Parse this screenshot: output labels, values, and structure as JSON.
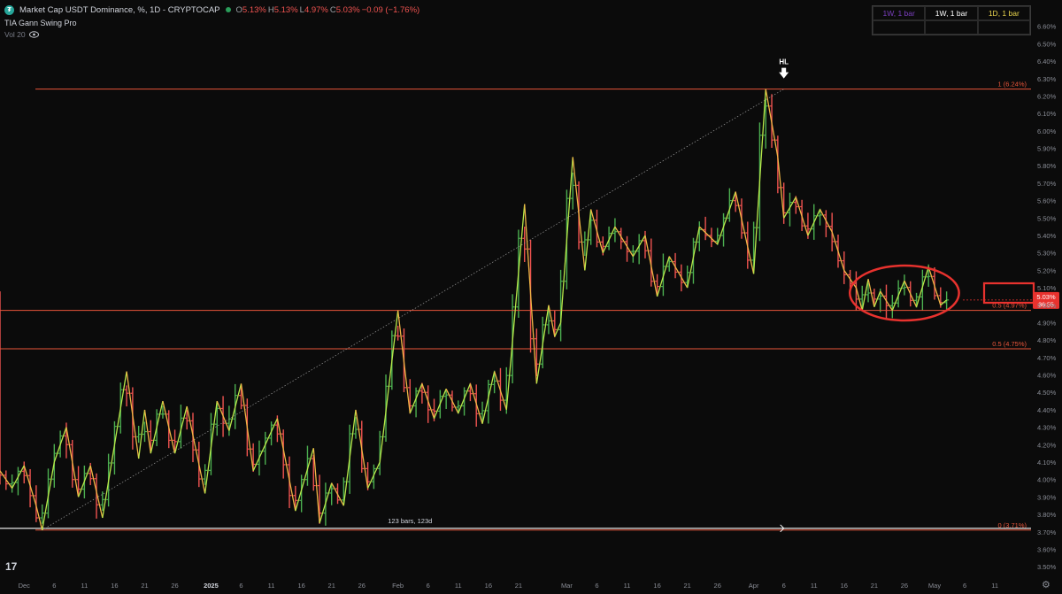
{
  "header": {
    "title": "Market Cap USDT Dominance, %, 1D - CRYPTOCAP",
    "ohlc": [
      {
        "k": "O",
        "v": "5.13%"
      },
      {
        "k": "H",
        "v": "5.13%"
      },
      {
        "k": "L",
        "v": "4.97%"
      },
      {
        "k": "C",
        "v": "5.03%"
      },
      {
        "k": "",
        "v": "−0.09 (−1.76%)"
      }
    ],
    "indicator": "TIA Gann Swing Pro",
    "volume": "Vol 20"
  },
  "tf_table": {
    "row1": [
      "1W, 1 bar",
      "1W, 1 bar",
      "1D, 1 bar"
    ],
    "row2": [
      "",
      "",
      ""
    ]
  },
  "colors": {
    "background": "#0b0b0b",
    "up": "#4caf50",
    "down": "#ef5350",
    "swing": "#e8e84a",
    "fib": "#e8553a",
    "price_tag": "#e8322e"
  },
  "icons": [
    "coin-icon",
    "eye-icon",
    "tradingview-logo-icon",
    "gear-icon",
    "down-arrow-icon"
  ],
  "chart_data": {
    "type": "line",
    "title": "Market Cap USDT Dominance, %, 1D - CRYPTOCAP",
    "ylim": [
      3.45,
      6.7
    ],
    "y_ticks": [
      "6.60%",
      "6.50%",
      "6.40%",
      "6.30%",
      "6.20%",
      "6.10%",
      "6.00%",
      "5.90%",
      "5.80%",
      "5.70%",
      "5.60%",
      "5.50%",
      "5.40%",
      "5.30%",
      "5.20%",
      "5.10%",
      "5.00%",
      "4.90%",
      "4.80%",
      "4.70%",
      "4.60%",
      "4.50%",
      "4.40%",
      "4.30%",
      "4.20%",
      "4.10%",
      "4.00%",
      "3.90%",
      "3.80%",
      "3.70%",
      "3.60%",
      "3.50%"
    ],
    "x_ticks": [
      "Dec",
      "6",
      "11",
      "16",
      "21",
      "26",
      "2025",
      "6",
      "11",
      "16",
      "21",
      "26",
      "Feb",
      "6",
      "11",
      "16",
      "21",
      "Mar",
      "6",
      "11",
      "16",
      "21",
      "26",
      "Apr",
      "6",
      "11",
      "16",
      "21",
      "26",
      "May",
      "6",
      "11"
    ],
    "x_tick_days": [
      0,
      5,
      10,
      15,
      20,
      25,
      31,
      36,
      41,
      46,
      51,
      56,
      62,
      67,
      72,
      77,
      82,
      90,
      95,
      100,
      105,
      110,
      115,
      121,
      126,
      131,
      136,
      141,
      146,
      151,
      156,
      161
    ],
    "x_range_days": [
      -4,
      167
    ],
    "current_price": {
      "price": "5.03%",
      "countdown": "36:55",
      "value": 5.03
    },
    "fib_levels": [
      {
        "label": "1 (6.24%)",
        "value": 6.24
      },
      {
        "label": "0.5 (4.97%)",
        "value": 4.97
      },
      {
        "label": "0.5 (4.75%)",
        "value": 4.75
      },
      {
        "label": "0 (3.71%)",
        "value": 3.71
      }
    ],
    "white_line": 3.71,
    "annotations": [
      {
        "text": "HL",
        "day": 126,
        "value": 6.24,
        "arrow": "down"
      },
      {
        "text": "123 bars, 123d",
        "day": 64,
        "value": 3.71
      }
    ],
    "trend_line": {
      "from_day": 3,
      "from": 3.71,
      "to_day": 126,
      "to": 6.24
    },
    "circled_region": {
      "from_day": 139,
      "to_day": 153,
      "center": 5.07
    },
    "swing": {
      "days": [
        -4,
        -2,
        0,
        2,
        3,
        5,
        7,
        9,
        11,
        13,
        15,
        17,
        19,
        20,
        21,
        23,
        25,
        27,
        30,
        32,
        34,
        36,
        38,
        42,
        45,
        48,
        49,
        51,
        53,
        55,
        57,
        59,
        62,
        64,
        66,
        68,
        70,
        72,
        74,
        76,
        78,
        80,
        83,
        85,
        87,
        88,
        89,
        91,
        93,
        94,
        96,
        98,
        101,
        103,
        105,
        107,
        110,
        112,
        115,
        118,
        121,
        123,
        125,
        126,
        128,
        130,
        132,
        134,
        136,
        138,
        139,
        140,
        141,
        142,
        144,
        146,
        148,
        150,
        152,
        153
      ],
      "values": [
        4.05,
        3.95,
        4.08,
        3.85,
        3.71,
        4.1,
        4.3,
        3.9,
        4.08,
        3.78,
        4.2,
        4.62,
        4.12,
        4.4,
        4.15,
        4.45,
        4.15,
        4.42,
        3.92,
        4.45,
        4.28,
        4.55,
        4.05,
        4.35,
        3.82,
        4.18,
        3.75,
        3.98,
        3.85,
        4.4,
        3.95,
        4.1,
        4.97,
        4.38,
        4.55,
        4.35,
        4.52,
        4.38,
        4.55,
        4.32,
        4.62,
        4.4,
        5.58,
        4.55,
        5.0,
        4.82,
        4.9,
        5.85,
        5.2,
        5.55,
        5.3,
        5.45,
        5.28,
        5.4,
        5.05,
        5.28,
        5.1,
        5.45,
        5.35,
        5.65,
        5.18,
        6.24,
        5.85,
        5.5,
        5.62,
        5.4,
        5.55,
        5.42,
        5.2,
        5.1,
        4.97,
        5.15,
        4.99,
        5.08,
        4.97,
        5.14,
        4.99,
        5.22,
        5.0,
        5.03
      ]
    }
  }
}
